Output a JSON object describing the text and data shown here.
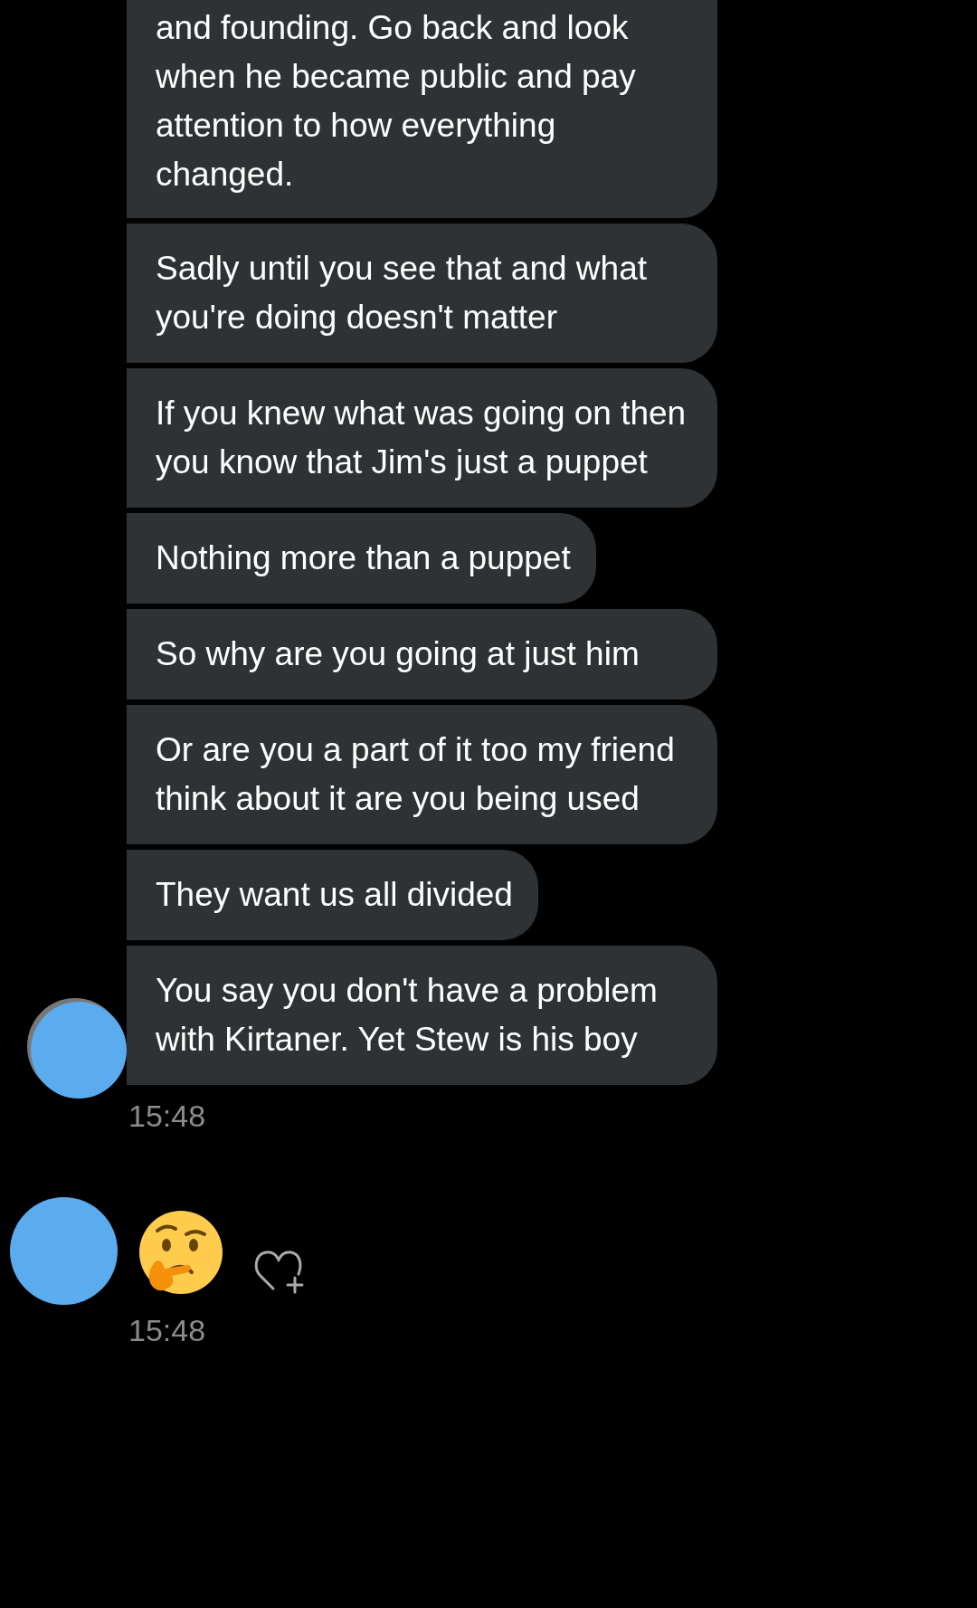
{
  "message_groups": [
    {
      "messages": [
        {
          "kind": "text",
          "text": "and founding. Go back and look when he became public and pay attention to how everything changed."
        },
        {
          "kind": "text",
          "text": "Sadly until you see that and what you're doing doesn't matter"
        },
        {
          "kind": "text",
          "text": "If you knew what was going on then you know that Jim's just a puppet"
        },
        {
          "kind": "text",
          "text": "Nothing more than a puppet"
        },
        {
          "kind": "text",
          "text": "So why are you going at just him"
        },
        {
          "kind": "text",
          "text": "Or are you a part of it too my friend think about it are you being used"
        },
        {
          "kind": "text",
          "text": "They want us all divided"
        },
        {
          "kind": "text",
          "text": "You say you don't have a problem with Kirtaner. Yet Stew is his boy"
        }
      ],
      "time": "15:48"
    },
    {
      "messages": [
        {
          "kind": "emoji"
        }
      ],
      "time": "15:48"
    }
  ]
}
